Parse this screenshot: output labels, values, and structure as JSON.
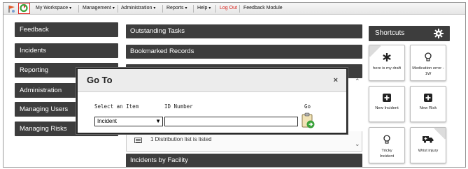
{
  "menubar": {
    "items": [
      {
        "label": "My Workspace",
        "dropdown": true
      },
      {
        "label": "Management",
        "dropdown": true
      },
      {
        "label": "Administration",
        "dropdown": true
      },
      {
        "label": "Reports",
        "dropdown": true
      },
      {
        "label": "Help",
        "dropdown": true
      },
      {
        "label": "Log Out",
        "dropdown": false
      },
      {
        "label": "Feedback Module",
        "dropdown": false
      }
    ],
    "icons": [
      "flag-icon",
      "home-icon"
    ]
  },
  "left_nav": [
    "Feedback",
    "Incidents",
    "Reporting",
    "Administration",
    "Managing Users",
    "Managing Risks"
  ],
  "center": {
    "panels": [
      "Outstanding Tasks",
      "Bookmarked Records"
    ],
    "distribution_text": "1 Distribution list is listed",
    "bottom_panel": "Incidents by Facility"
  },
  "shortcuts": {
    "title": "Shortcuts",
    "tiles": [
      {
        "label": "here is my draft",
        "icon": "asterisk-icon"
      },
      {
        "label": "Medication error - 1W",
        "icon": "lightbulb-icon"
      },
      {
        "label": "New Incident",
        "icon": "plus-square-icon"
      },
      {
        "label": "New Risk",
        "icon": "plus-square-icon"
      },
      {
        "label": "Tricky Incident",
        "icon": "lightbulb-icon"
      },
      {
        "label": "Wrist injury",
        "icon": "ambulance-icon"
      }
    ]
  },
  "modal": {
    "title": "Go To",
    "close": "×",
    "select_label": "Select an Item",
    "id_label": "ID Number",
    "go_label": "Go",
    "select_value": "Incident",
    "id_value": ""
  },
  "colors": {
    "bar": "#3d3d3d",
    "logout": "#d9221c",
    "home_highlight": "#e0302a",
    "home_icon": "#3aa23a"
  }
}
